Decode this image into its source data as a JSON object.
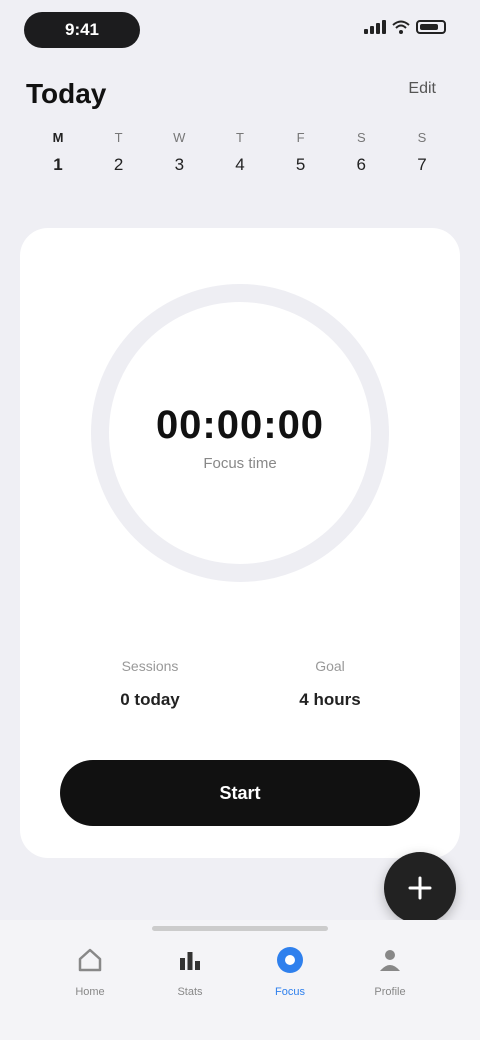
{
  "status_bar": {
    "time": "9:41"
  },
  "header": {
    "title": "Today",
    "action_label": "Edit"
  },
  "week": [
    {
      "letter": "M",
      "num": "1",
      "active": true
    },
    {
      "letter": "T",
      "num": "2",
      "active": false
    },
    {
      "letter": "W",
      "num": "3",
      "active": false
    },
    {
      "letter": "T",
      "num": "4",
      "active": false
    },
    {
      "letter": "F",
      "num": "5",
      "active": false
    },
    {
      "letter": "S",
      "num": "6",
      "active": false
    },
    {
      "letter": "S",
      "num": "7",
      "active": false
    }
  ],
  "timer": {
    "value": "00:00:00",
    "caption": "Focus time",
    "progress": 0.0
  },
  "stats": [
    {
      "label": "Sessions",
      "value": "0 today"
    },
    {
      "label": "Goal",
      "value": "4 hours"
    }
  ],
  "primary_button_label": "Start",
  "nav": [
    {
      "label": "Home",
      "icon": "home-icon",
      "active": false
    },
    {
      "label": "Stats",
      "icon": "chart-icon",
      "active": false
    },
    {
      "label": "Focus",
      "icon": "focus-icon",
      "active": true
    },
    {
      "label": "Profile",
      "icon": "person-icon",
      "active": false
    }
  ],
  "colors": {
    "accent": "#2f80ed",
    "button": "#111111",
    "background": "#efeff4"
  }
}
